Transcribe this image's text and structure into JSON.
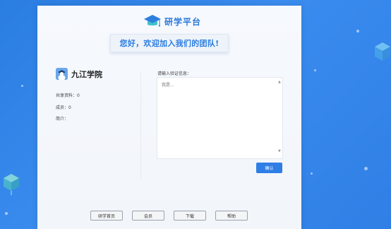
{
  "brand": {
    "name": "研学平台",
    "icon": "graduation-cap-icon",
    "color": "#2a78d8"
  },
  "welcome": "您好，欢迎加入我们的团队!",
  "school": {
    "name": "九江学院",
    "avatar_icon": "school-avatar-icon"
  },
  "stats": {
    "shared_resources_label": "共享资料：",
    "shared_resources_value": "0",
    "members_label": "成员：",
    "members_value": "0",
    "intro_label": "简介："
  },
  "verify": {
    "label": "请输入验证信息：",
    "placeholder": "我是..."
  },
  "confirm_label": "确认",
  "footer": {
    "buttons": [
      "研学首页",
      "会员",
      "下载",
      "帮助"
    ]
  },
  "colors": {
    "accent": "#2f7ee6",
    "background": "#2a7de1"
  }
}
